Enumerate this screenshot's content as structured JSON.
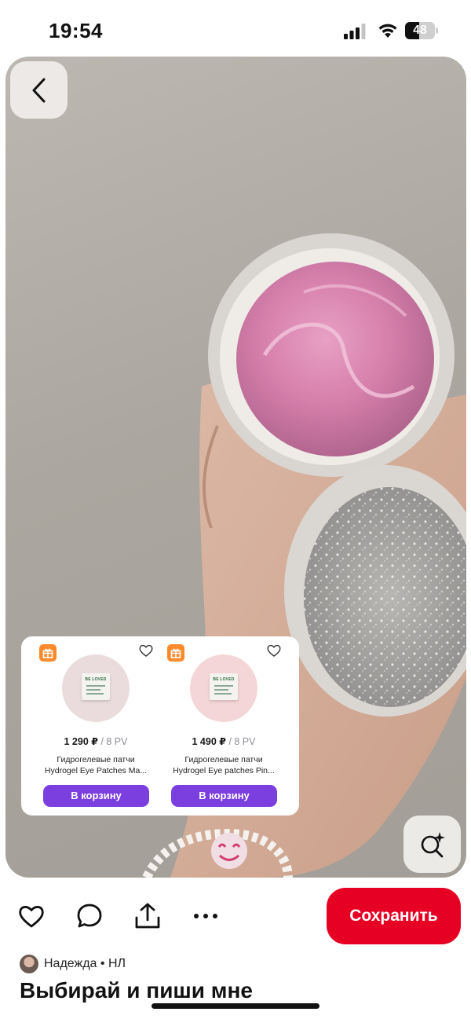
{
  "status_bar": {
    "time": "19:54",
    "battery_percent": 48
  },
  "product_panel": {
    "products": [
      {
        "price": "1 290 ₽",
        "pv": "/ 8 PV",
        "name_line1": "Гидрогелевые патчи",
        "name_line2": "Hydrogel Eye Patches Ma...",
        "cart_label": "В корзину",
        "pack_brand": "BE LOVED",
        "thumb_color": "#eadcdc"
      },
      {
        "price": "1 490 ₽",
        "pv": "/ 8 PV",
        "name_line1": "Гидрогелевые патчи",
        "name_line2": "Hydrogel Eye patches Pin...",
        "cart_label": "В корзину",
        "pack_brand": "BE LOVED",
        "thumb_color": "#f4d6d8"
      }
    ]
  },
  "actions": {
    "save_label": "Сохранить"
  },
  "author": {
    "name": "Надежда • НЛ"
  },
  "pin": {
    "title": "Выбирай и пиши мне"
  },
  "icons": {
    "back": "chevron-left-icon",
    "lens": "visual-search-icon",
    "like": "heart-icon",
    "comment": "comment-icon",
    "share": "share-icon",
    "more": "more-icon",
    "gift": "gift-icon",
    "favorite": "heart-outline-icon"
  },
  "colors": {
    "save_button": "#e60023",
    "cart_button": "#7b3fe0",
    "gift_badge": "#ff8a2c"
  }
}
